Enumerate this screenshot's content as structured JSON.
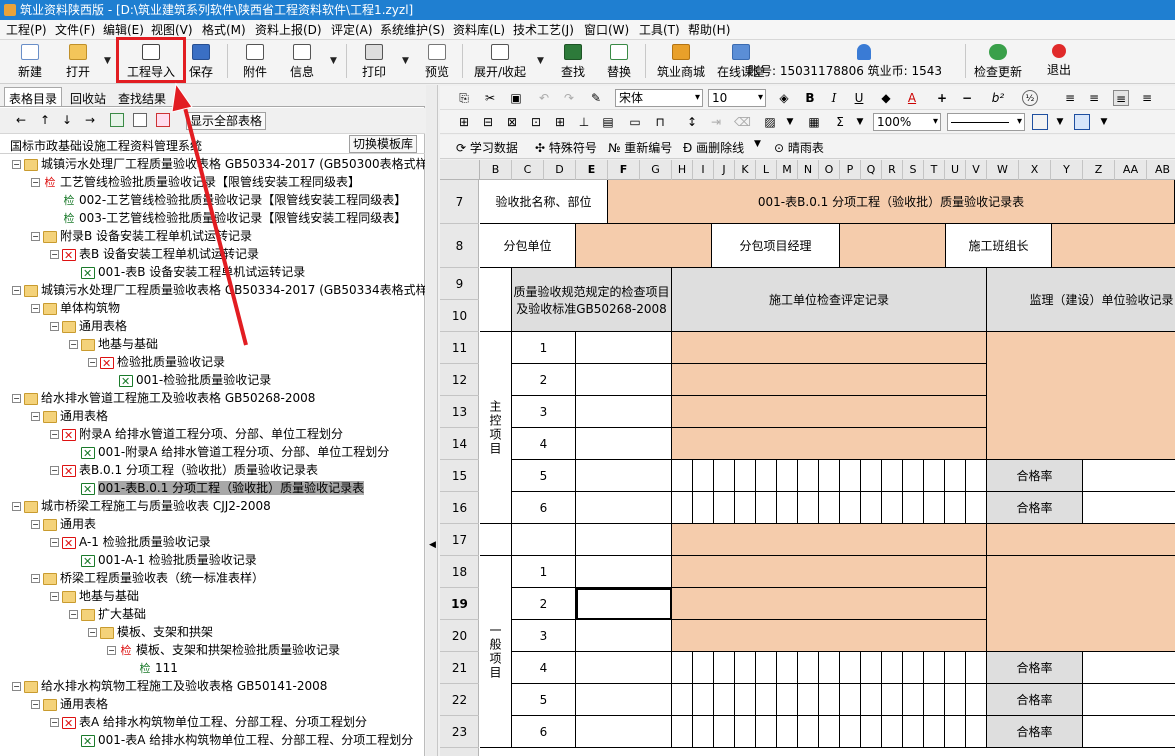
{
  "app": {
    "title": "筑业资料陕西版 - [D:\\筑业建筑系列软件\\陕西省工程资料软件\\工程1.zyzl]"
  },
  "menu": [
    "工程(P)",
    "文件(F)",
    "编辑(E)",
    "视图(V)",
    "格式(M)",
    "资料上报(D)",
    "评定(A)",
    "系统维护(S)",
    "资料库(L)",
    "技术工艺(J)",
    "窗口(W)",
    "工具(T)",
    "帮助(H)"
  ],
  "toolbar": {
    "new": "新建",
    "open": "打开",
    "import": "工程导入",
    "save": "保存",
    "attach": "附件",
    "info": "信息",
    "print": "打印",
    "preview": "预览",
    "expand": "展开/收起",
    "find": "查找",
    "replace": "替换",
    "mall": "筑业商城",
    "classroom": "在线课堂",
    "account": "账号: 15031178806 筑业币: 1543",
    "update": "检查更新",
    "exit": "退出"
  },
  "left": {
    "tabs": [
      "表格目录",
      "回收站",
      "查找结果"
    ],
    "show_all": "显示全部表格",
    "filter_name": "国标市政基础设施工程资料管理系统",
    "switch_template": "切换模板库"
  },
  "tree": [
    {
      "text": "城镇污水处理厂工程质量验收表格 GB50334-2017 (GB50300表格式样)",
      "icon": "folder",
      "level": 0
    },
    {
      "text": "工艺管线检验批质量验收记录【限管线安装工程同级表】",
      "icon": "jian-red",
      "level": 1
    },
    {
      "text": "002-工艺管线检验批质量验收记录【限管线安装工程同级表】",
      "icon": "jian-green",
      "level": 2
    },
    {
      "text": "003-工艺管线检验批质量验收记录【限管线安装工程同级表】",
      "icon": "jian-green",
      "level": 2
    },
    {
      "text": "附录B 设备安装工程单机试运转记录",
      "icon": "folder",
      "level": 1
    },
    {
      "text": "表B 设备安装工程单机试运转记录",
      "icon": "redx",
      "level": 2
    },
    {
      "text": "001-表B 设备安装工程单机试运转记录",
      "icon": "greenx",
      "level": 3
    },
    {
      "text": "城镇污水处理厂工程质量验收表格 GB50334-2017 (GB50334表格式样)",
      "icon": "folder",
      "level": 0
    },
    {
      "text": "单体构筑物",
      "icon": "folder",
      "level": 1
    },
    {
      "text": "通用表格",
      "icon": "folder",
      "level": 2
    },
    {
      "text": "地基与基础",
      "icon": "folder",
      "level": 3
    },
    {
      "text": "检验批质量验收记录",
      "icon": "redx",
      "level": 4
    },
    {
      "text": "001-检验批质量验收记录",
      "icon": "greenx",
      "level": 5
    },
    {
      "text": "给水排水管道工程施工及验收表格 GB50268-2008",
      "icon": "folder",
      "level": 0
    },
    {
      "text": "通用表格",
      "icon": "folder",
      "level": 1
    },
    {
      "text": "附录A 给排水管道工程分项、分部、单位工程划分",
      "icon": "redx",
      "level": 2
    },
    {
      "text": "001-附录A 给排水管道工程分项、分部、单位工程划分",
      "icon": "greenx",
      "level": 3
    },
    {
      "text": "表B.0.1 分项工程（验收批）质量验收记录表",
      "icon": "redx",
      "level": 2
    },
    {
      "text": "001-表B.0.1 分项工程（验收批）质量验收记录表",
      "icon": "greenx",
      "level": 3,
      "selected": true
    },
    {
      "text": "城市桥梁工程施工与质量验收表 CJJ2-2008",
      "icon": "folder",
      "level": 0
    },
    {
      "text": "通用表",
      "icon": "folder",
      "level": 1
    },
    {
      "text": "A-1 检验批质量验收记录",
      "icon": "redx",
      "level": 2
    },
    {
      "text": "001-A-1 检验批质量验收记录",
      "icon": "greenx",
      "level": 3
    },
    {
      "text": "桥梁工程质量验收表（统一标准表样）",
      "icon": "folder",
      "level": 1
    },
    {
      "text": "地基与基础",
      "icon": "folder",
      "level": 2
    },
    {
      "text": "扩大基础",
      "icon": "folder",
      "level": 3
    },
    {
      "text": "模板、支架和拱架",
      "icon": "folder",
      "level": 4
    },
    {
      "text": "模板、支架和拱架检验批质量验收记录",
      "icon": "jian-red",
      "level": 5
    },
    {
      "text": "111",
      "icon": "jian-green",
      "level": 6
    },
    {
      "text": "给水排水构筑物工程施工及验收表格 GB50141-2008",
      "icon": "folder",
      "level": 0
    },
    {
      "text": "通用表格",
      "icon": "folder",
      "level": 1
    },
    {
      "text": "表A 给排水构筑物单位工程、分部工程、分项工程划分",
      "icon": "redx",
      "level": 2
    },
    {
      "text": "001-表A 给排水构筑物单位工程、分部工程、分项工程划分",
      "icon": "greenx",
      "level": 3
    }
  ],
  "format_bar": {
    "font": "宋体",
    "size": "10",
    "zoom": "100%"
  },
  "sheet_bar": {
    "learn": "学习数据",
    "special": "特殊符号",
    "renumber": "重新编号",
    "delete_line": "画删除线",
    "clear": "晴雨表"
  },
  "columns": [
    "B",
    "C",
    "D",
    "E",
    "F",
    "G",
    "H",
    "I",
    "J",
    "K",
    "L",
    "M",
    "N",
    "O",
    "P",
    "Q",
    "R",
    "S",
    "T",
    "U",
    "V",
    "W",
    "X",
    "Y",
    "Z",
    "AA",
    "AB"
  ],
  "rows": [
    "7",
    "8",
    "9",
    "10",
    "11",
    "12",
    "13",
    "14",
    "15",
    "16",
    "17",
    "18",
    "19",
    "20",
    "21",
    "22",
    "23"
  ],
  "form": {
    "batch_label": "验收批名称、部位",
    "batch_value": "001-表B.0.1 分项工程（验收批）质量验收记录表",
    "sub_unit": "分包单位",
    "sub_manager": "分包项目经理",
    "team_leader": "施工班组长",
    "standard": "质量验收规范规定的检查项目及验收标准GB50268-2008",
    "construction_record": "施工单位检查评定记录",
    "supervision_record": "监理（建设）单位验收记录",
    "main_items": "主控项目",
    "general_items": "一般项目",
    "pass_rate": "合格率",
    "main_nums": [
      "1",
      "2",
      "3",
      "4",
      "5",
      "6"
    ],
    "general_nums": [
      "1",
      "2",
      "3",
      "4",
      "5",
      "6"
    ]
  }
}
